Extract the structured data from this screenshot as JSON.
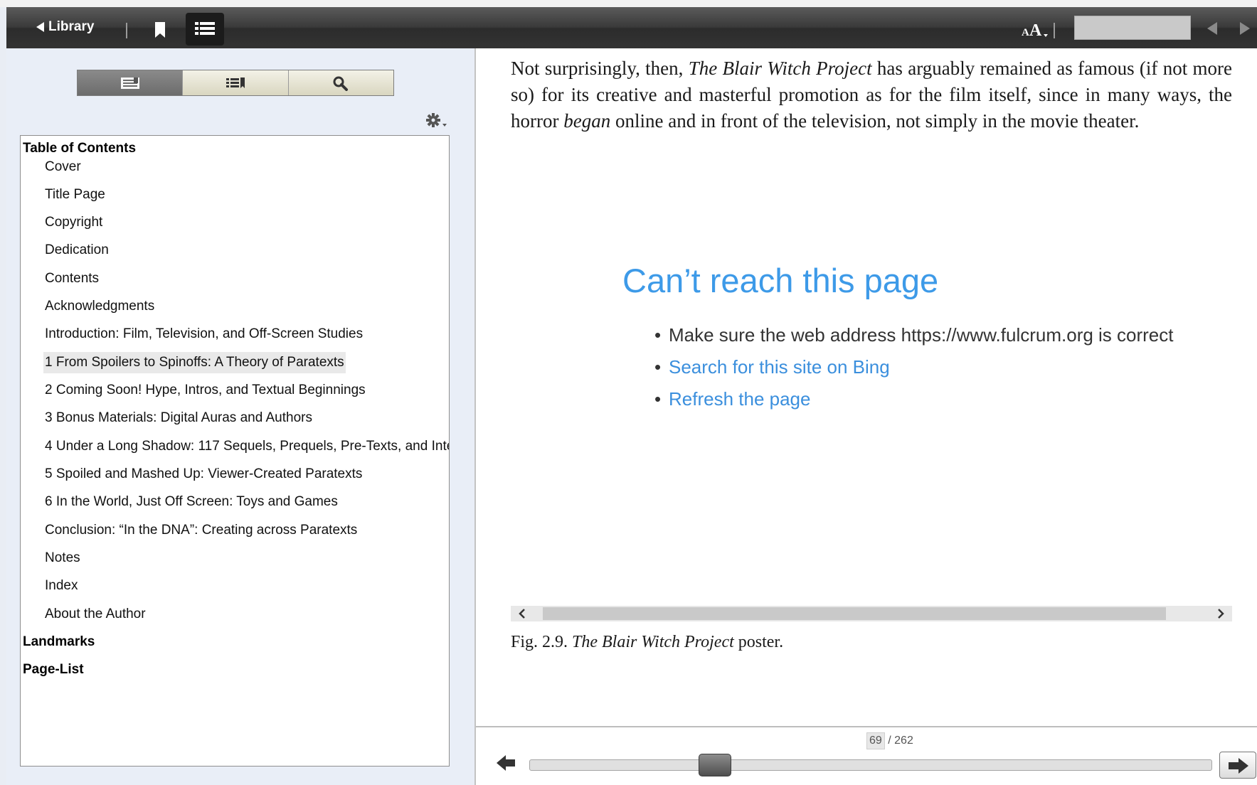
{
  "toolbar": {
    "library_label": "Library",
    "icons": [
      "bookmark-icon",
      "toc-list-icon",
      "font-size-icon",
      "prev-page-icon",
      "next-page-icon"
    ]
  },
  "sidebar": {
    "tabs": [
      {
        "name": "toc-tab-icon",
        "active": true
      },
      {
        "name": "bookmarks-tab-icon",
        "active": false
      },
      {
        "name": "search-tab-icon",
        "active": false
      }
    ],
    "toc_header": "Table of Contents",
    "toc_items": [
      "Cover",
      "Title Page",
      "Copyright",
      "Dedication",
      "Contents",
      "Acknowledgments",
      "Introduction: Film, Television, and Off-Screen Studies",
      "1 From Spoilers to Spinoffs: A Theory of Paratexts",
      "2 Coming Soon! Hype, Intros, and Textual Beginnings",
      "3 Bonus Materials: Digital Auras and Authors",
      "4 Under a Long Shadow: 117 Sequels, Prequels, Pre-Texts, and Inte",
      "5 Spoiled and Mashed Up: Viewer-Created Paratexts",
      "6 In the World, Just Off Screen: Toys and Games",
      "Conclusion: “In the DNA”: Creating across Paratexts",
      "Notes",
      "Index",
      "About the Author"
    ],
    "selected_index": 7,
    "landmarks_label": "Landmarks",
    "page_list_label": "Page-List"
  },
  "content": {
    "para_a": "Not surprisingly, then, ",
    "para_b": "The Blair Witch Project",
    "para_c": " has arguably remained as famous (if not more so) for its creative and masterful promotion as for the film itself, since in many ways, the horror ",
    "para_d": "began",
    "para_e": " online and in front of the television, not simply in the movie theater.",
    "error": {
      "title": "Can’t reach this page",
      "bullet": "•",
      "item1": "Make sure the web address https://www.fulcrum.org is correct",
      "link1": "Search for this site on Bing",
      "link2": "Refresh the page"
    },
    "caption_a": "Fig. 2.9. ",
    "caption_b": "The Blair Witch Project",
    "caption_c": " poster."
  },
  "footer": {
    "current_page": "69",
    "total": "/ 262",
    "progress": 0.26
  },
  "colors": {
    "accent_link": "#3b8fdd",
    "error_title": "#3d9ae8",
    "toolbar": "#3a3a3a"
  }
}
